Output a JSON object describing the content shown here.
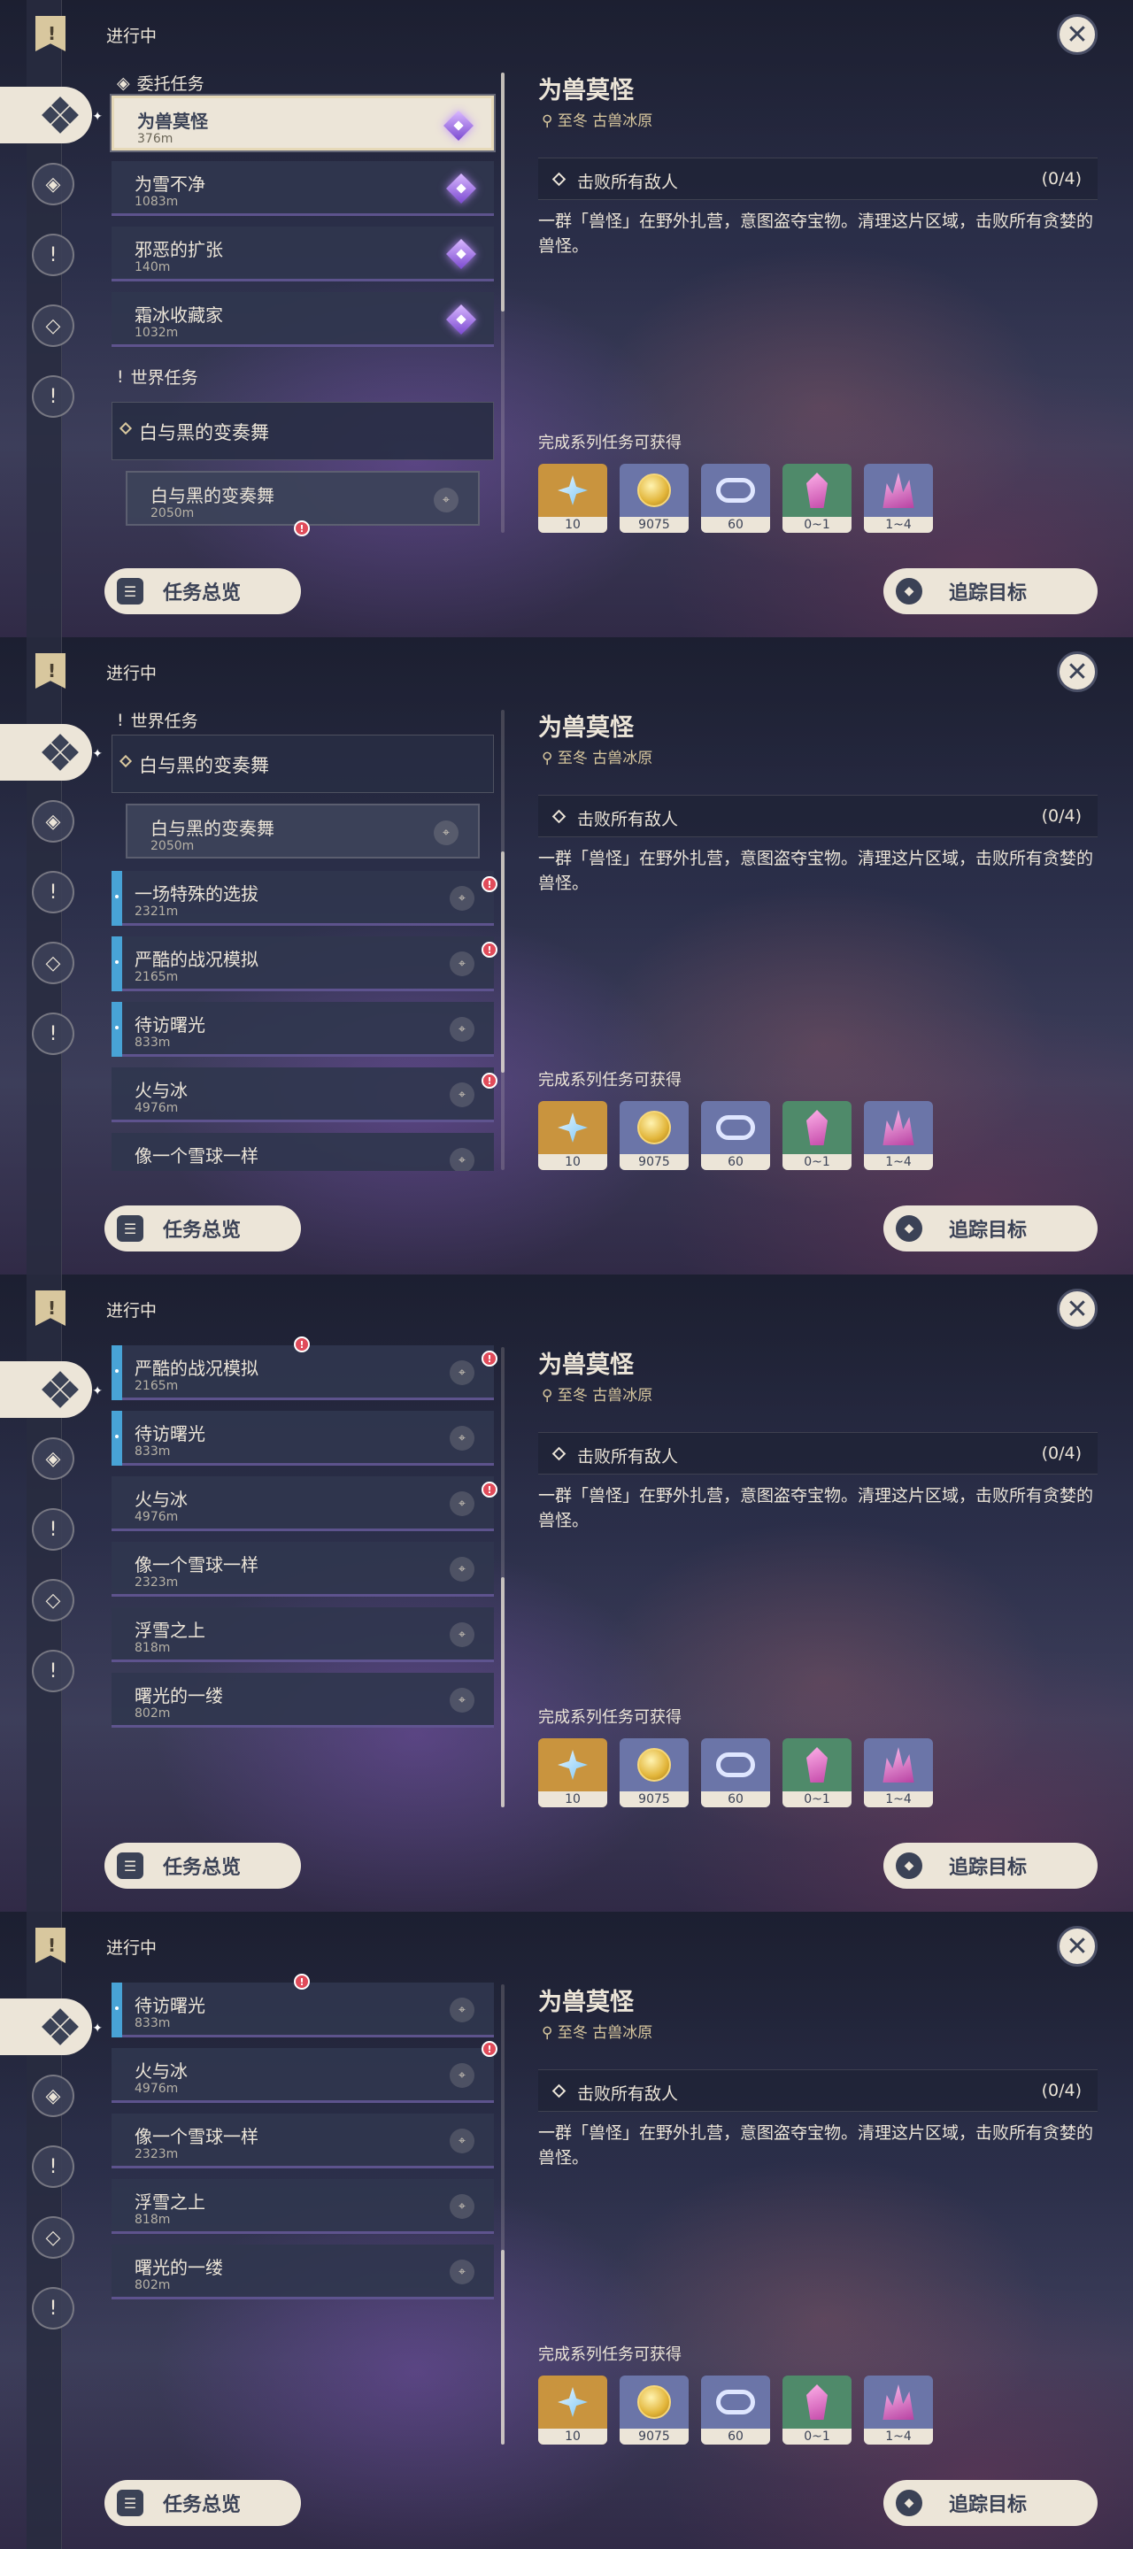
{
  "common": {
    "ongoing_label": "进行中",
    "close_icon": "✕",
    "quest_title": "为兽莫怪",
    "location": "至冬 古兽冰原",
    "objective": "击败所有敌人",
    "progress": "(0/4)",
    "description": "一群「兽怪」在野外扎营，意图盗夺宝物。清理这片区域，击败所有贪婪的兽怪。",
    "rewards_label": "完成系列任务可获得",
    "rewards": [
      {
        "icon": "primogem-icon",
        "amount": "10",
        "bg": "#c9943e"
      },
      {
        "icon": "mora-icon",
        "amount": "9075",
        "bg": "#6b75a8"
      },
      {
        "icon": "hero-wit-icon",
        "amount": "60",
        "bg": "#6b75a8"
      },
      {
        "icon": "crystal-chunk-icon",
        "amount": "0~1",
        "bg": "#4f8a6a"
      },
      {
        "icon": "crystal-cluster-icon",
        "amount": "1~4",
        "bg": "#6b75a8"
      }
    ],
    "overview_button": "任务总览",
    "track_button": "追踪目标"
  },
  "sections": {
    "commission": "委托任务",
    "world": "世界任务"
  },
  "quests": {
    "q1": {
      "title": "为兽莫怪",
      "dist": "376m"
    },
    "q2": {
      "title": "为雪不净",
      "dist": "1083m"
    },
    "q3": {
      "title": "邪恶的扩张",
      "dist": "140m"
    },
    "q4": {
      "title": "霜冰收藏家",
      "dist": "1032m"
    },
    "world_head": {
      "title": "白与黑的变奏舞"
    },
    "w0": {
      "title": "白与黑的变奏舞",
      "dist": "2050m"
    },
    "w1": {
      "title": "一场特殊的选拔",
      "dist": "2321m"
    },
    "w2": {
      "title": "严酷的战况模拟",
      "dist": "2165m"
    },
    "w3": {
      "title": "待访曙光",
      "dist": "833m"
    },
    "w4": {
      "title": "火与冰",
      "dist": "4976m"
    },
    "w5": {
      "title": "像一个雪球一样",
      "dist": "2323m"
    },
    "w6": {
      "title": "浮雪之上",
      "dist": "818m"
    },
    "w7": {
      "title": "曙光的一缕",
      "dist": "802m"
    }
  },
  "colors": {
    "accent_cream": "#ece5d8",
    "gold": "#d8c79e",
    "alert_red": "#e04b5a",
    "world_quest_bar": "#48a3d6"
  }
}
